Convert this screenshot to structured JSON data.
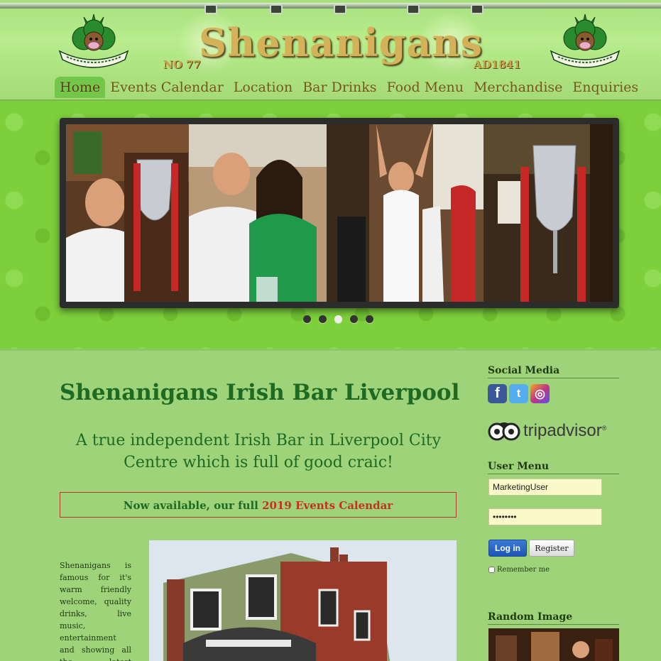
{
  "brand": {
    "name": "Shenanigans",
    "number": "NO 77",
    "established": "AD1841"
  },
  "nav": [
    {
      "label": "Home",
      "active": true
    },
    {
      "label": "Events Calendar"
    },
    {
      "label": "Location"
    },
    {
      "label": "Bar Drinks"
    },
    {
      "label": "Food Menu"
    },
    {
      "label": "Merchandise"
    },
    {
      "label": "Enquiries"
    }
  ],
  "slider": {
    "slides": 5,
    "active_index": 2
  },
  "content": {
    "title": "Shenanigans Irish Bar Liverpool",
    "tagline": "A true independent Irish Bar in Liverpool City Centre which is full of good craic!",
    "notice_prefix": "Now available, our full ",
    "notice_link": "2019 Events Calendar",
    "intro": "Shenanigans is famous for it's warm friendly welcome, quality drinks, live music, entertainment and showing all the latest sporting events"
  },
  "sidebar": {
    "social_heading": "Social Media",
    "social": [
      {
        "icon": "facebook-icon",
        "glyph": "f",
        "color": "#3b5998"
      },
      {
        "icon": "twitter-icon",
        "glyph": "t",
        "color": "#55acee"
      },
      {
        "icon": "instagram-icon",
        "glyph": "◎",
        "color": "#c13584"
      }
    ],
    "tripadvisor": "tripadvisor",
    "tripadvisor_mark": "®",
    "user_menu_heading": "User Menu",
    "username_value": "MarketingUser",
    "password_value": "••••••••",
    "login_label": "Log in",
    "register_label": "Register",
    "remember_label": "Remember me",
    "random_image_heading": "Random Image"
  },
  "colors": {
    "accent_green": "#1e6a23",
    "link_red": "#c4311f",
    "nav_gold": "#6b5a18"
  }
}
